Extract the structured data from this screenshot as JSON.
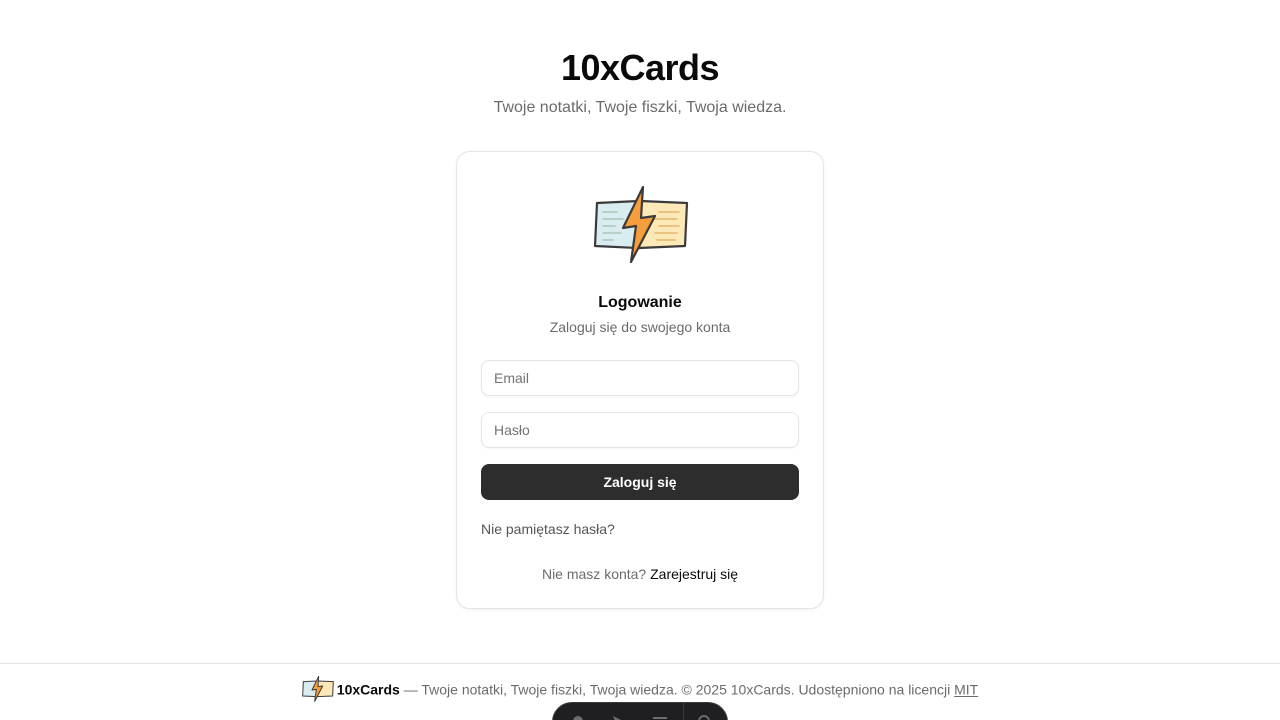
{
  "app": {
    "title": "10xCards",
    "tagline": "Twoje notatki, Twoje fiszki, Twoja wiedza."
  },
  "login": {
    "logo_icon": "flashcards-lightning-logo",
    "title": "Logowanie",
    "subtitle": "Zaloguj się do swojego konta",
    "email_placeholder": "Email",
    "password_placeholder": "Hasło",
    "submit_label": "Zaloguj się",
    "forgot_password_label": "Nie pamiętasz hasła?",
    "register_prompt": "Nie masz konta?",
    "register_label": "Zarejestruj się"
  },
  "footer": {
    "brand": "10xCards",
    "text": "— Twoje notatki, Twoje fiszki, Twoja wiedza. © 2025 10xCards. Udostępniono na licencji",
    "license_label": "MIT"
  },
  "colors": {
    "primary_button": "#2d2d2d",
    "muted_text": "#6b6b6b",
    "border": "#e4e4e7",
    "logo_orange": "#f59e3b",
    "logo_card_left": "#d9ecf0",
    "logo_card_right": "#fde9b8"
  }
}
